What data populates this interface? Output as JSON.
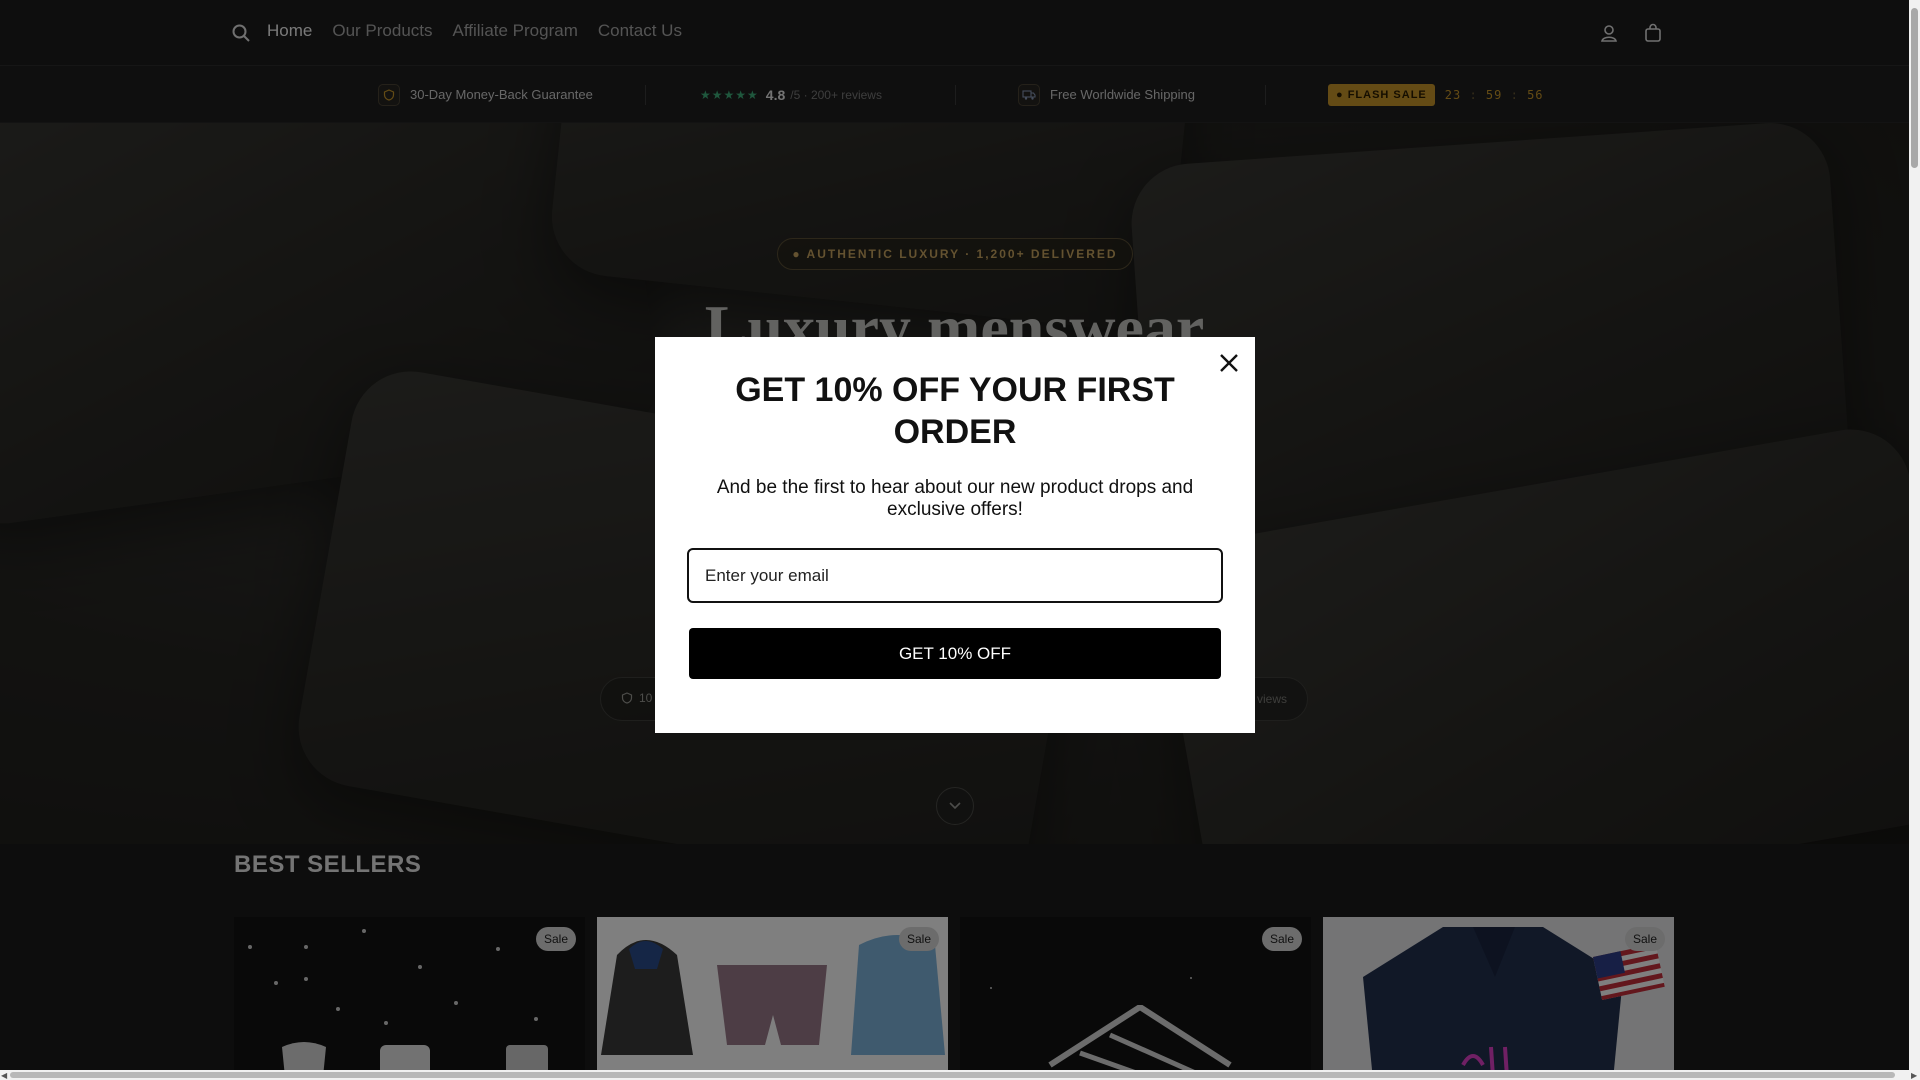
{
  "header": {
    "nav": [
      "Home",
      "Our Products",
      "Affiliate Program",
      "Contact Us"
    ],
    "icons": [
      "search-icon",
      "account-icon",
      "cart-icon"
    ]
  },
  "trustbar": {
    "guarantee": "30-Day Money-Back Guarantee",
    "stars": "★★★★★",
    "rating": "4.8",
    "rating_scale": "/5 · 200+ reviews",
    "shipping": "Free Worldwide Shipping",
    "flash_label": "● FLASH SALE",
    "countdown": {
      "hours": "23",
      "minutes": "59",
      "seconds": "56"
    },
    "accent_color": "#c8962a"
  },
  "hero": {
    "pill": "● AUTHENTIC LUXURY · 1,200+ DELIVERED",
    "title": "Luxury menswear",
    "badge_left": "10",
    "badge_right": "views"
  },
  "best_sellers": {
    "title": "BEST SELLERS",
    "sale_label": "Sale"
  },
  "popup": {
    "title": "GET 10% OFF YOUR FIRST ORDER",
    "subtitle": "And be the first to hear about our new product drops and exclusive offers!",
    "email_placeholder": "Enter your email",
    "button": "GET 10% OFF"
  }
}
